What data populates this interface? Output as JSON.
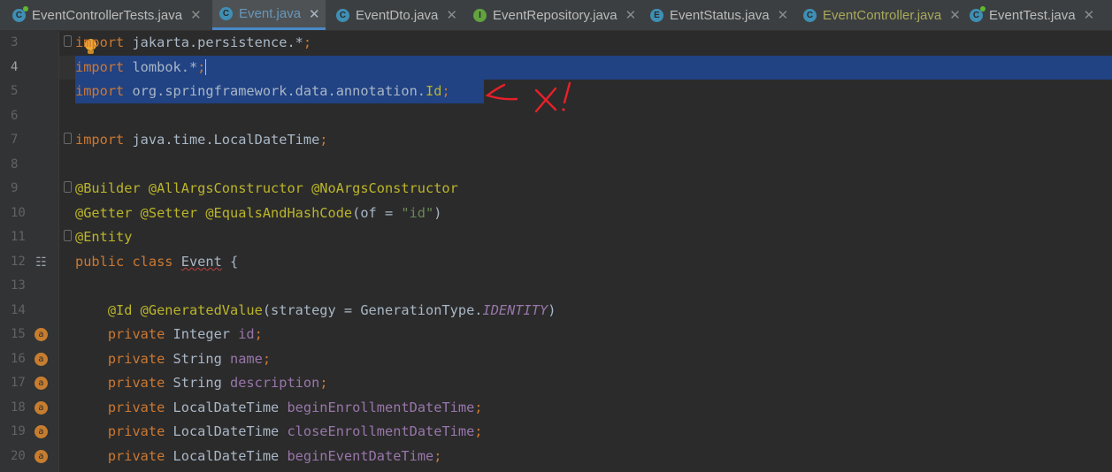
{
  "tabs": [
    {
      "label": "EventControllerTests.java",
      "icon": "class-test-icon",
      "color": "#bbbbbb",
      "active": false
    },
    {
      "label": "Event.java",
      "icon": "class-icon",
      "color": "#6897bb",
      "active": true
    },
    {
      "label": "EventDto.java",
      "icon": "class-icon",
      "color": "#bbbbbb",
      "active": false
    },
    {
      "label": "EventRepository.java",
      "icon": "interface-icon",
      "color": "#bbbbbb",
      "active": false
    },
    {
      "label": "EventStatus.java",
      "icon": "enum-icon",
      "color": "#bbbbbb",
      "active": false
    },
    {
      "label": "EventController.java",
      "icon": "class-icon",
      "color": "#a9a95a",
      "active": false
    },
    {
      "label": "EventTest.java",
      "icon": "class-test-icon",
      "color": "#bbbbbb",
      "active": false
    }
  ],
  "editor": {
    "line_numbers": [
      "3",
      "4",
      "5",
      "6",
      "7",
      "8",
      "9",
      "10",
      "11",
      "12",
      "13",
      "14",
      "15",
      "16",
      "17",
      "18",
      "19",
      "20"
    ],
    "lines": [
      "import jakarta.persistence.*;",
      "import lombok.*;",
      "import org.springframework.data.annotation.Id;",
      "",
      "import java.time.LocalDateTime;",
      "",
      "@Builder @AllArgsConstructor @NoArgsConstructor",
      "@Getter @Setter @EqualsAndHashCode(of = \"id\")",
      "@Entity",
      "public class Event {",
      "",
      "    @Id @GeneratedValue(strategy = GenerationType.IDENTITY)",
      "    private Integer id;",
      "    private String name;",
      "    private String description;",
      "    private LocalDateTime beginEnrollmentDateTime;",
      "    private LocalDateTime closeEnrollmentDateTime;",
      "    private LocalDateTime beginEventDateTime;"
    ]
  },
  "annotation": {
    "text": "← ✗!",
    "color": "#e8202a"
  },
  "colors": {
    "keyword": "#cc7832",
    "annotation": "#bbb529",
    "string": "#6a8759",
    "field": "#9876aa",
    "selection": "#214283"
  }
}
